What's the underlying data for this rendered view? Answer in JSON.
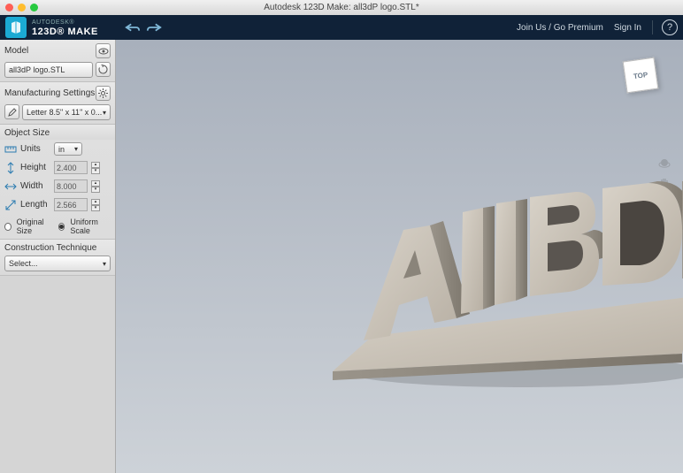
{
  "title": "Autodesk 123D Make: all3dP logo.STL*",
  "brand": {
    "line1": "AUTODESK®",
    "line2": "123D® MAKE"
  },
  "header": {
    "join": "Join Us / Go Premium",
    "signin": "Sign In"
  },
  "sidebar": {
    "model": {
      "header": "Model",
      "file": "all3dP logo.STL"
    },
    "manuf": {
      "header": "Manufacturing Settings",
      "preset": "Letter 8.5\" x 11\" x 0..."
    },
    "objsize": {
      "header": "Object Size",
      "units_label": "Units",
      "units_value": "in",
      "height_label": "Height",
      "height_value": "2.400",
      "width_label": "Width",
      "width_value": "8.000",
      "length_label": "Length",
      "length_value": "2.566",
      "orig": "Original Size",
      "uniform": "Uniform Scale"
    },
    "construction": {
      "header": "Construction Technique",
      "value": "Select..."
    }
  },
  "viewcube": "TOP"
}
